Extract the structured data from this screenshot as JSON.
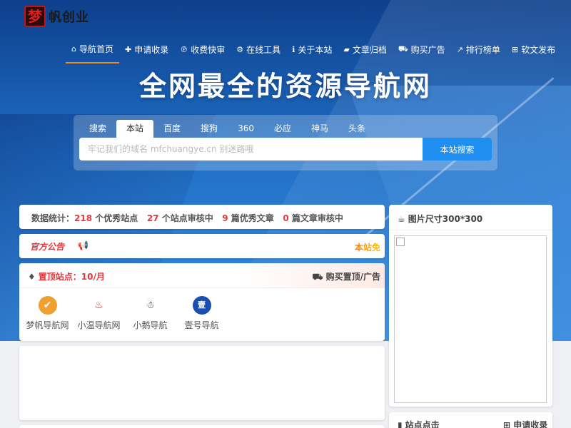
{
  "logo": {
    "mark": "梦",
    "text": "帆创业"
  },
  "nav": [
    {
      "icon": "⌂",
      "icon_name": "home-icon",
      "label": "导航首页"
    },
    {
      "icon": "✚",
      "icon_name": "plus-square-icon",
      "label": "申请收录"
    },
    {
      "icon": "℗",
      "icon_name": "paypal-icon",
      "label": "收费快审"
    },
    {
      "icon": "⚙",
      "icon_name": "cogs-icon",
      "label": "在线工具"
    },
    {
      "icon": "ℹ",
      "icon_name": "info-circle-icon",
      "label": "关于本站"
    },
    {
      "icon": "▰",
      "icon_name": "folder-open-icon",
      "label": "文章归档"
    },
    {
      "icon": "⛟",
      "icon_name": "shopping-cart-icon",
      "label": "购买广告"
    },
    {
      "icon": "↗",
      "icon_name": "line-chart-icon",
      "label": "排行榜单"
    },
    {
      "icon": "⊞",
      "icon_name": "th-icon",
      "label": "软文发布"
    }
  ],
  "hero": {
    "title": "全网最全的资源导航网"
  },
  "search": {
    "tabs": [
      "搜索",
      "本站",
      "百度",
      "搜狗",
      "360",
      "必应",
      "神马",
      "头条"
    ],
    "active_tab": "本站",
    "placeholder": "牢记我们的域名 mfchuangye.cn 别迷路哦",
    "button": "本站搜索"
  },
  "stats": {
    "prefix": "数据统计：",
    "sites": "218",
    "sites_label": " 个优秀站点",
    "pending_sites": "27",
    "pending_sites_label": " 个站点审核中",
    "articles": "9",
    "articles_label": " 篇优秀文章",
    "pending_articles": "0",
    "pending_articles_label": " 篇文章审核中"
  },
  "notice": {
    "label": "官方公告",
    "icon": "📢",
    "scroll_text": "本站免"
  },
  "pinned": {
    "title": "置顶站点：10/月",
    "buy_label": "购买置顶/广告",
    "sites": [
      {
        "name": "梦帆导航网",
        "glyph": "✔",
        "color": "#f0a030"
      },
      {
        "name": "小温导航网",
        "glyph": "♨",
        "color": "#d01818"
      },
      {
        "name": "小鹅导航",
        "glyph": "☃",
        "color": "#222222"
      },
      {
        "name": "壹号导航",
        "glyph": "壹",
        "color": "#1a4fb0"
      }
    ]
  },
  "ad": {
    "title": "图片尺寸300*300"
  },
  "clicks": {
    "title": "站点点击",
    "apply": "申请收录"
  },
  "colors": {
    "accent": "#1e8ef0",
    "red": "#e4393c",
    "nav_underline": "#f08a1c"
  }
}
